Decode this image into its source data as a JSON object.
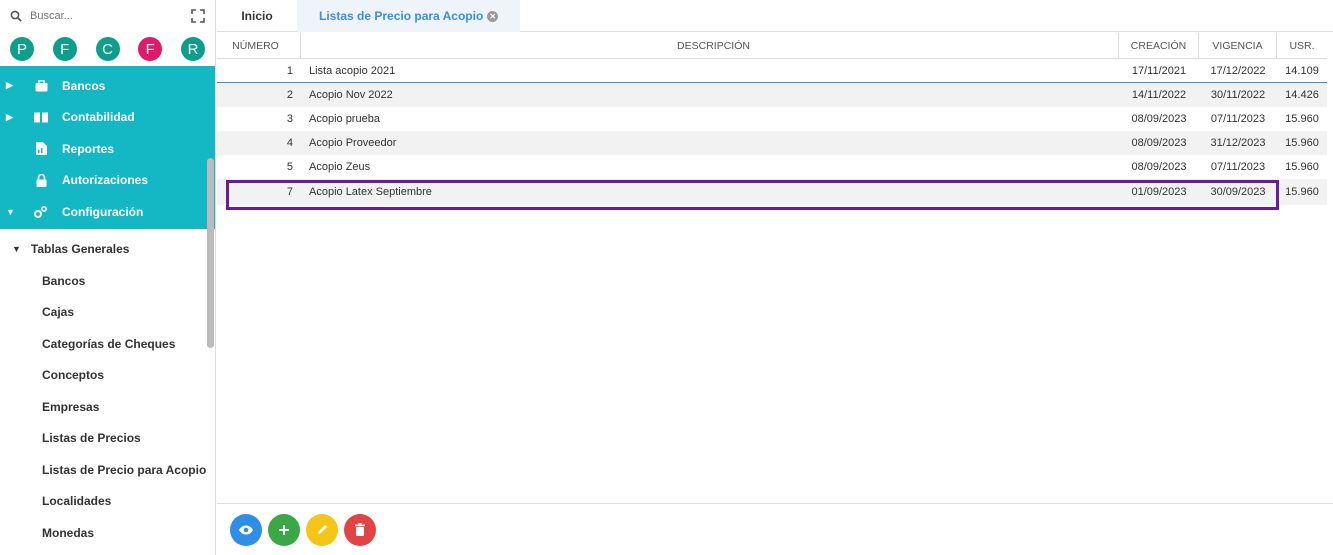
{
  "search": {
    "placeholder": "Buscar..."
  },
  "avatars": [
    {
      "letter": "P",
      "color": "#0e9f8c"
    },
    {
      "letter": "F",
      "color": "#0e9f8c"
    },
    {
      "letter": "C",
      "color": "#0e9f8c"
    },
    {
      "letter": "F",
      "color": "#e0196a"
    },
    {
      "letter": "R",
      "color": "#0e9f8c"
    }
  ],
  "menu": {
    "bancos": "Bancos",
    "contabilidad": "Contabilidad",
    "reportes": "Reportes",
    "autorizaciones": "Autorizaciones",
    "configuracion": "Configuración"
  },
  "submenu": {
    "header": "Tablas Generales",
    "items": [
      "Bancos",
      "Cajas",
      "Categorías de Cheques",
      "Conceptos",
      "Empresas",
      "Listas de Precios",
      "Listas de Precio para Acopio",
      "Localidades",
      "Monedas"
    ]
  },
  "tabs": {
    "inicio": "Inicio",
    "active": "Listas de Precio para Acopio"
  },
  "table": {
    "headers": {
      "num": "NÚMERO",
      "desc": "DESCRIPCIÓN",
      "cre": "CREACIÓN",
      "vig": "VIGENCIA",
      "usr": "USR."
    },
    "rows": [
      {
        "num": "1",
        "desc": "Lista acopio 2021",
        "cre": "17/11/2021",
        "vig": "17/12/2022",
        "usr": "14.109"
      },
      {
        "num": "2",
        "desc": "Acopio Nov 2022",
        "cre": "14/11/2022",
        "vig": "30/11/2022",
        "usr": "14.426"
      },
      {
        "num": "3",
        "desc": "Acopio prueba",
        "cre": "08/09/2023",
        "vig": "07/11/2023",
        "usr": "15.960"
      },
      {
        "num": "4",
        "desc": "Acopio Proveedor",
        "cre": "08/09/2023",
        "vig": "31/12/2023",
        "usr": "15.960"
      },
      {
        "num": "5",
        "desc": "Acopio Zeus",
        "cre": "08/09/2023",
        "vig": "07/11/2023",
        "usr": "15.960"
      },
      {
        "num": "7",
        "desc": "Acopio Latex Septiembre",
        "cre": "01/09/2023",
        "vig": "30/09/2023",
        "usr": "15.960"
      }
    ]
  },
  "actions": {
    "view": {
      "icon": "eye-icon",
      "color": "#2f8fe8"
    },
    "add": {
      "icon": "plus-icon",
      "color": "#3aa845"
    },
    "edit": {
      "icon": "pencil-icon",
      "color": "#f5c518"
    },
    "delete": {
      "icon": "trash-icon",
      "color": "#e24444"
    }
  },
  "colors": {
    "teal": "#14b8c4",
    "highlight": "#6a1b9a",
    "accent": "#3a8ee6"
  }
}
